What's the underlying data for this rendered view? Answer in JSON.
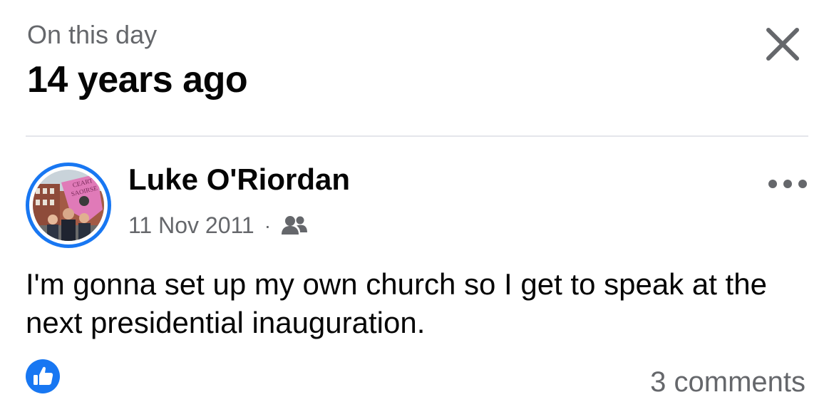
{
  "header": {
    "eyebrow": "On this day",
    "title": "14 years ago"
  },
  "post": {
    "author": "Luke O'Riordan",
    "date": "11 Nov 2011",
    "separator": "·",
    "audience_icon": "friends-icon",
    "text": "I'm gonna set up my own church so I get to speak at the next presidential inauguration.",
    "reaction_icon": "like-icon",
    "comments_label": "3 comments",
    "avatar_sign_text": "CEART SAOIRSE"
  },
  "colors": {
    "accent": "#1877f2",
    "secondary_text": "#65676b",
    "divider": "#e4e6eb",
    "primary_text": "#050505"
  }
}
